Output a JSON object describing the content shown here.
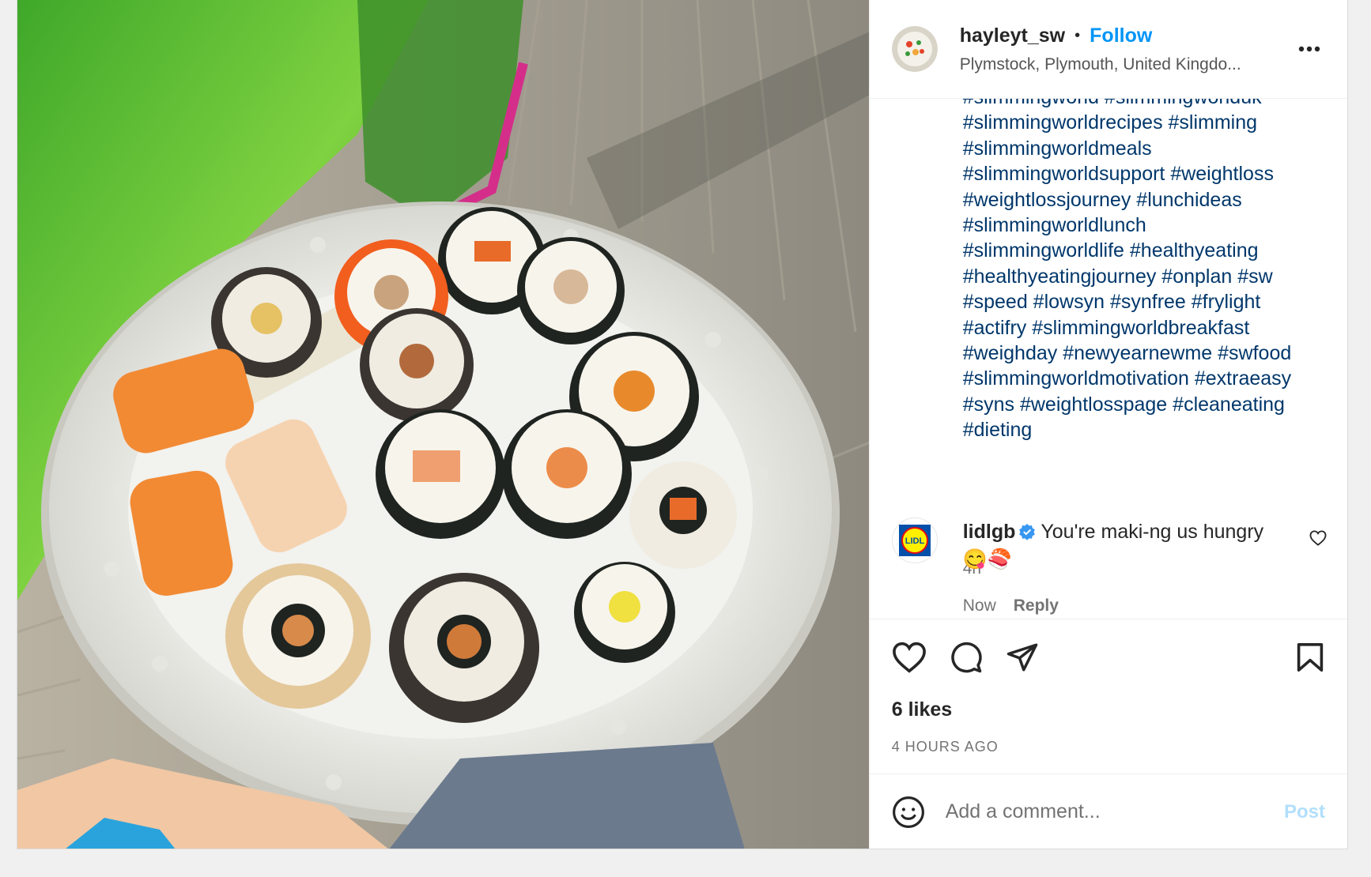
{
  "post": {
    "username": "hayleyt_sw",
    "separator": "•",
    "follow_label": "Follow",
    "location": "Plymstock, Plymouth, United Kingdo...",
    "caption_lines": [
      "#slimmingworld #slimmingworlduk",
      "#slimmingworldrecipes #slimming",
      "#slimmingworldmeals",
      "#slimmingworldsupport #weightloss",
      "#weightlossjourney #lunchideas",
      "#slimmingworldlunch",
      "#slimmingworldlife #healthyeating",
      "#healthyeatingjourney #onplan #sw",
      "#speed #lowsyn #synfree #frylight",
      "#actifry #slimmingworldbreakfast",
      "#weighday #newyearnewme #swfood",
      "#slimmingworldmotivation #extraeasy",
      "#syns #weightlosspage #cleaneating",
      "#dieting"
    ],
    "caption_time": "4h",
    "likes": "6 likes",
    "posted_ago": "4 HOURS AGO"
  },
  "comment": {
    "username": "lidlgb",
    "avatar_logo_text": "LIDL",
    "text": "You're maki-ng us hungry",
    "emojis": "😋🍣",
    "time": "Now",
    "reply_label": "Reply"
  },
  "add_comment": {
    "placeholder": "Add a comment...",
    "post_label": "Post"
  },
  "icons": [
    "more-icon",
    "heart-icon",
    "comment-icon",
    "share-icon",
    "bookmark-icon",
    "emoji-icon",
    "verified-icon",
    "comment-heart-icon"
  ],
  "colors": {
    "link": "#0095f6",
    "hashtag": "#00376b",
    "muted": "#737373",
    "post_disabled": "#b2dffc",
    "lidl_blue": "#0050aa",
    "lidl_yellow": "#fff000",
    "lidl_red": "#e60a14"
  }
}
